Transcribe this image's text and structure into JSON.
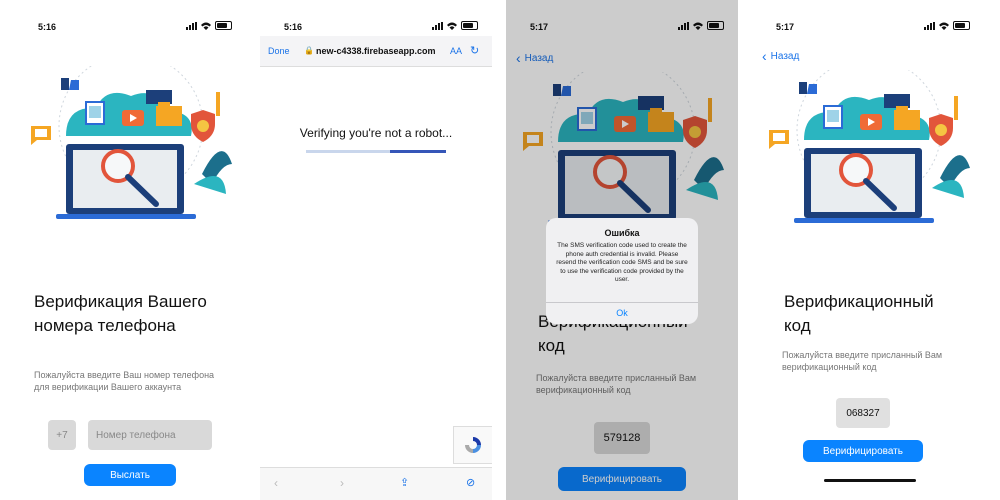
{
  "screens": [
    {
      "time": "5:16",
      "title_line1": "Верификация Вашего",
      "title_line2": "номера телефона",
      "subtitle_line1": "Пожалуйста введите Ваш номер телефона",
      "subtitle_line2": "для верификации Вашего аккаунта",
      "country_code": "+7",
      "phone_placeholder": "Номер телефона",
      "send_button": "Выслать"
    },
    {
      "time": "5:16",
      "done_label": "Done",
      "url": "new-c4338.firebaseapp.com",
      "text_size_label": "AA",
      "verifying_text": "Verifying you're not a robot...",
      "progress": 0.6
    },
    {
      "time": "5:17",
      "back_label": "Назад",
      "title_line1": "Верификационный",
      "title_line2": "код",
      "subtitle_line1": "Пожалуйста введите присланный Вам",
      "subtitle_line2": "верификационный код",
      "code_value": "579128",
      "verify_button": "Верифицировать",
      "alert": {
        "title": "Ошибка",
        "message": "The SMS verification code used to create the phone auth credential is invalid. Please resend the verification code SMS and be sure to use the verification code provided by the user.",
        "ok_label": "Ok"
      }
    },
    {
      "time": "5:17",
      "back_label": "Назад",
      "title_line1": "Верификационный",
      "title_line2": "код",
      "subtitle_line1": "Пожалуйста введите присланный Вам",
      "subtitle_line2": "верификационный код",
      "code_value": "068327",
      "verify_button": "Верифицировать"
    }
  ],
  "colors": {
    "accent": "#0a84ff",
    "teal": "#2bb5c0",
    "navy": "#1c3f7a",
    "orange": "#f5a623",
    "red": "#e2553b"
  },
  "icons": [
    "signal-icon",
    "wifi-icon",
    "battery-icon",
    "chevron-left-icon",
    "lock-icon",
    "reload-icon",
    "recaptcha-icon",
    "share-icon",
    "compass-icon"
  ]
}
